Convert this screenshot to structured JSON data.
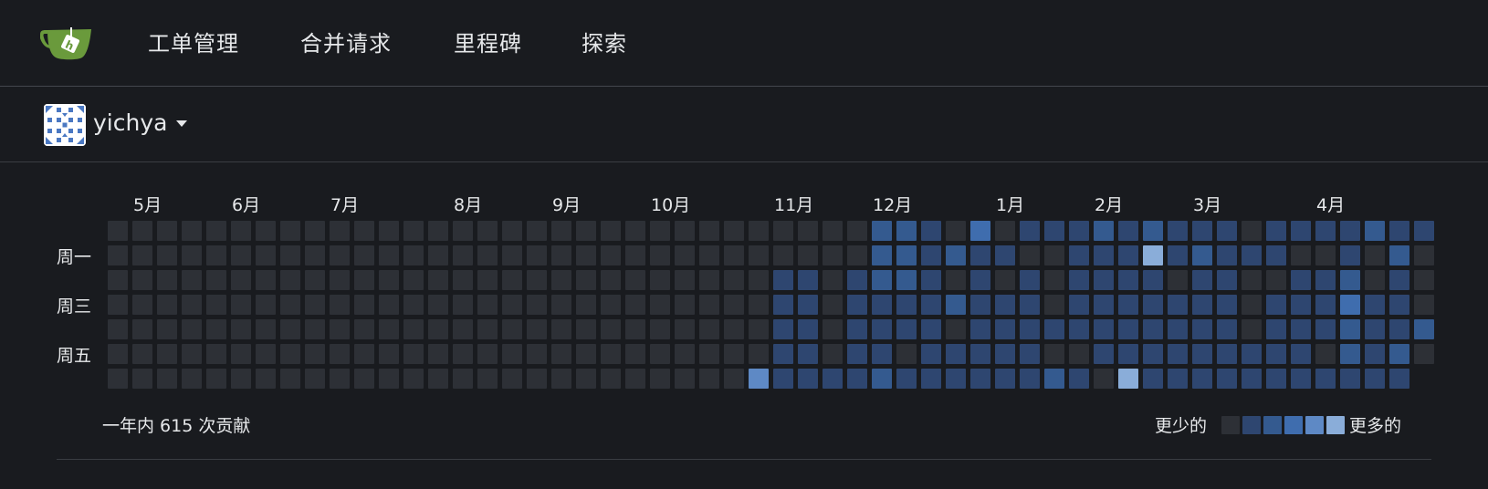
{
  "nav": {
    "items": [
      "工单管理",
      "合并请求",
      "里程碑",
      "探索"
    ]
  },
  "context": {
    "username": "yichya"
  },
  "heatmap": {
    "months": [
      "5月",
      "6月",
      "7月",
      "8月",
      "9月",
      "10月",
      "11月",
      "12月",
      "1月",
      "2月",
      "3月",
      "4月"
    ],
    "month_start_weeks": [
      1,
      5,
      9,
      14,
      18,
      22,
      27,
      31,
      36,
      40,
      44,
      49
    ],
    "day_labels": [
      "周一",
      "周三",
      "周五"
    ],
    "total_text": "一年内 615 次贡献",
    "legend_less": "更少的",
    "legend_more": "更多的",
    "colors": [
      "#2d3036",
      "#2e4670",
      "#345a8f",
      "#3f6dae",
      "#5e89c5",
      "#8aadd9"
    ],
    "levels": [
      "0000000",
      "0000000",
      "0000000",
      "0000000",
      "0000000",
      "0000000",
      "0000000",
      "0000000",
      "0000000",
      "0000000",
      "0000000",
      "0000000",
      "0000000",
      "0000000",
      "0000000",
      "0000000",
      "0000000",
      "0000000",
      "0000000",
      "0000000",
      "0000000",
      "0000000",
      "0000000",
      "0000000",
      "0000000",
      "0000000",
      "0000004",
      "0011111",
      "0011111",
      "0000001",
      "0011111",
      "2221112",
      "2221101",
      "1111111",
      "0202011",
      "3111111",
      "0101111",
      "1011111",
      "1000102",
      "1111101",
      "2111110",
      "1111115",
      "2511111",
      "1101111",
      "1211111",
      "1111111",
      "0100011",
      "1101111",
      "1011111",
      "1011101",
      "1123221",
      "2001111",
      "1211121",
      "100020"
    ]
  }
}
